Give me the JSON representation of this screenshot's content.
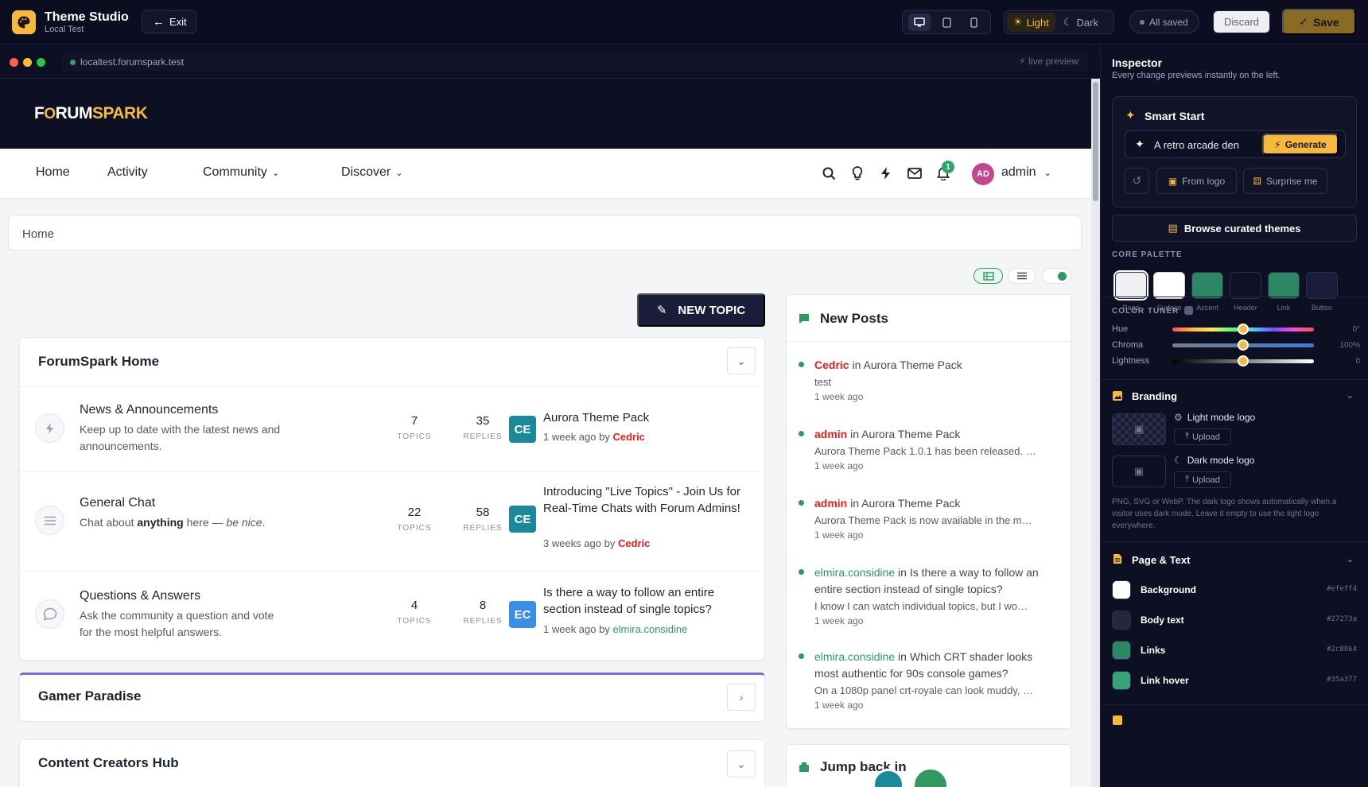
{
  "app": {
    "title": "Theme Studio",
    "subtitle": "Local Test",
    "exit_label": "Exit"
  },
  "toolbar": {
    "devices": [
      "desktop-icon",
      "tablet-icon",
      "mobile-icon"
    ],
    "modes": [
      {
        "label": "Light",
        "active": true
      },
      {
        "label": "Dark",
        "active": false
      }
    ],
    "saved_label": "All saved",
    "discard_label": "Discard",
    "save_label": "Save"
  },
  "browser": {
    "url": "localtest.forumspark.test",
    "live_label": "live preview"
  },
  "site": {
    "logo_left": "F",
    "logo_o": "O",
    "logo_rest": "RUM",
    "logo_accent": "SPARK",
    "nav": [
      {
        "label": "Home"
      },
      {
        "label": "Activity"
      },
      {
        "label": "Community"
      },
      {
        "label": "Discover"
      }
    ],
    "notif_count": "1",
    "user_initials": "AD",
    "user_name": "admin",
    "breadcrumb": "Home",
    "new_topic_label": "NEW TOPIC"
  },
  "categories": [
    {
      "title": "ForumSpark Home",
      "forums": [
        {
          "name": "News & Announcements",
          "desc": "Keep up to date with the latest news and announcements.",
          "topics": "7",
          "replies": "35",
          "topics_label": "TOPICS",
          "replies_label": "REPLIES",
          "avatar": "CE",
          "avatar_color": "#1a8a9a",
          "last_title": "Aurora Theme Pack",
          "last_time": "1 week ago by ",
          "last_user": "Cedric"
        },
        {
          "name": "General Chat",
          "desc_pre": "Chat about ",
          "desc_bold": "anything",
          "desc_mid": " here — ",
          "desc_it": "be nice",
          "desc_end": ".",
          "topics": "22",
          "replies": "58",
          "topics_label": "TOPICS",
          "replies_label": "REPLIES",
          "avatar": "CE",
          "avatar_color": "#1a8a9a",
          "last_title": "Introducing \"Live Topics\" - Join Us for Real-Time Chats with Forum Admins!",
          "last_time": "3 weeks ago by ",
          "last_user": "Cedric"
        },
        {
          "name": "Questions & Answers",
          "desc": "Ask the community a question and vote for the most helpful answers.",
          "topics": "4",
          "replies": "8",
          "topics_label": "TOPICS",
          "replies_label": "REPLIES",
          "avatar": "EC",
          "avatar_color": "#3a8ee6",
          "last_title": "Is there a way to follow an entire section instead of single topics?",
          "last_time": "1 week ago by ",
          "last_user": "elmira.considine"
        }
      ]
    },
    {
      "title": "Gamer Paradise"
    },
    {
      "title": "Content Creators Hub"
    }
  ],
  "new_posts": {
    "title": "New Posts",
    "items": [
      {
        "user": "Cedric",
        "user_style": "red",
        "in": " in ",
        "topic": "Aurora Theme Pack",
        "excerpt": "test",
        "time": "1 week ago"
      },
      {
        "user": "admin",
        "user_style": "red",
        "in": " in ",
        "topic": "Aurora Theme Pack",
        "excerpt": "Aurora Theme Pack 1.0.1 has been released. …",
        "time": "1 week ago"
      },
      {
        "user": "admin",
        "user_style": "red",
        "in": " in ",
        "topic": "Aurora Theme Pack",
        "excerpt": "Aurora Theme Pack is now available in the m…",
        "time": "1 week ago"
      },
      {
        "user": "elmira.considine",
        "user_style": "green",
        "in": " in ",
        "topic": "Is there a way to follow an entire section instead of single topics?",
        "excerpt": "I know I can watch individual topics, but I wo…",
        "time": "1 week ago"
      },
      {
        "user": "elmira.considine",
        "user_style": "green",
        "in": " in ",
        "topic": "Which CRT shader looks most authentic for 90s console games?",
        "excerpt": "On a 1080p panel crt-royale can look muddy, …",
        "time": "1 week ago"
      }
    ]
  },
  "jump_back": {
    "title": "Jump back in"
  },
  "inspector": {
    "title": "Inspector",
    "subtitle": "Every change previews instantly on the left.",
    "smart_start": {
      "title": "Smart Start",
      "prompt": "A retro arcade den",
      "generate": "Generate",
      "from_logo": "From logo",
      "surprise": "Surprise me"
    },
    "browse_label": "Browse curated themes",
    "core_palette_label": "CORE PALETTE",
    "palette": [
      {
        "name": "Page",
        "color": "#efeff4"
      },
      {
        "name": "Surface",
        "color": "#ffffff"
      },
      {
        "name": "Accent",
        "color": "#2c8864"
      },
      {
        "name": "Header",
        "color": "#0f1024"
      },
      {
        "name": "Link",
        "color": "#2c8864"
      },
      {
        "name": "Button",
        "color": "#1a1c3a"
      }
    ],
    "color_tuner_label": "COLOR TUNER",
    "tuner": [
      {
        "name": "Hue",
        "value": "0°",
        "level": 0.5
      },
      {
        "name": "Chroma",
        "value": "100%",
        "level": 0.5
      },
      {
        "name": "Lightness",
        "value": "0",
        "level": 0.5
      }
    ],
    "branding": {
      "title": "Branding",
      "light_logo": "Light mode logo",
      "dark_logo": "Dark mode logo",
      "upload": "Upload",
      "hint": "PNG, SVG or WebP. The dark logo shows automatically when a visitor uses dark mode. Leave it empty to use the light logo everywhere."
    },
    "page_text": {
      "title": "Page & Text",
      "rows": [
        {
          "name": "Background",
          "hex": "#efeff4",
          "color": "#ffffff"
        },
        {
          "name": "Body text",
          "hex": "#27273a",
          "color": "#27273a"
        },
        {
          "name": "Links",
          "hex": "#2c8864",
          "color": "#2c8864"
        },
        {
          "name": "Link hover",
          "hex": "#35a377",
          "color": "#35a377"
        }
      ]
    }
  }
}
